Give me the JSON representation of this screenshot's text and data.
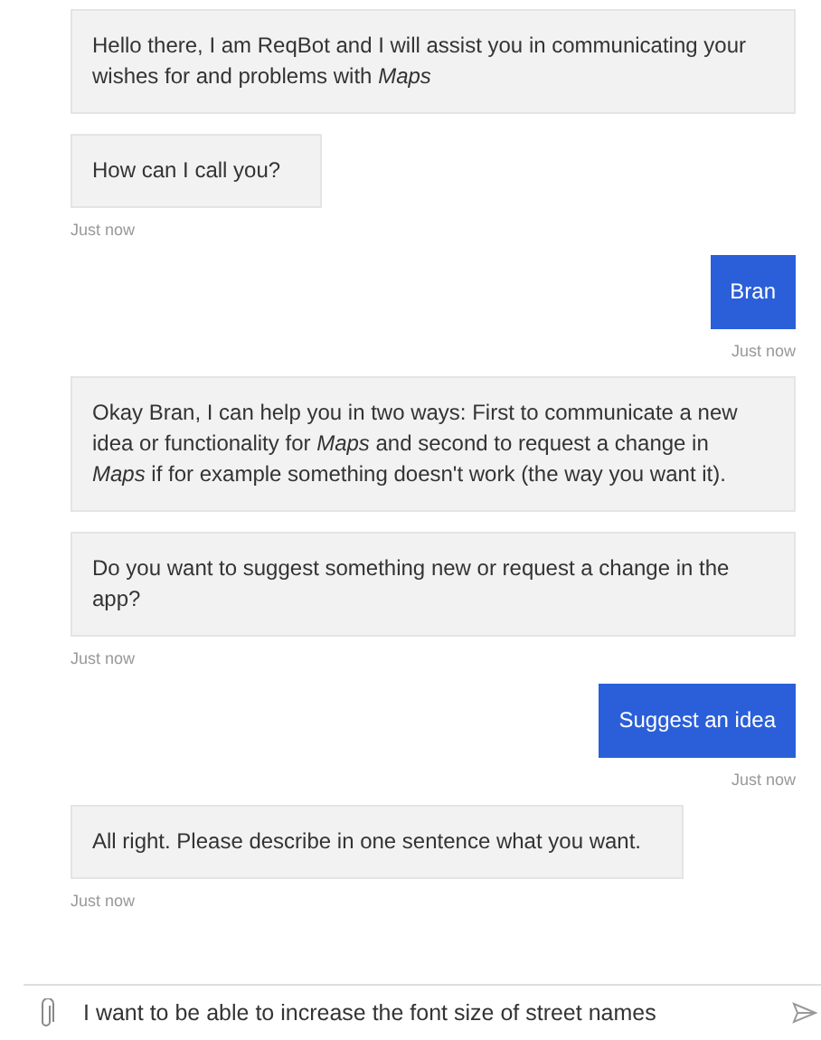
{
  "messages": [
    {
      "kind": "bot",
      "bubbles": [
        "Hello there, I am ReqBot and I will assist you in communicating your wishes for and problems with *Maps*",
        "How can I call you?"
      ],
      "time": "Just now"
    },
    {
      "kind": "user",
      "bubbles": [
        "Bran"
      ],
      "time": "Just now"
    },
    {
      "kind": "bot",
      "bubbles": [
        "Okay Bran, I can help you in two ways: First to communicate a new idea or functionality for *Maps* and second to request a change in *Maps* if for example something doesn't work (the way you want it).",
        "Do you want to suggest something new or request a change in the app?"
      ],
      "time": "Just now"
    },
    {
      "kind": "user",
      "bubbles": [
        "Suggest an idea"
      ],
      "time": "Just now"
    },
    {
      "kind": "bot",
      "bubbles": [
        "All right. Please describe in one sentence what you want."
      ],
      "time": "Just now"
    }
  ],
  "composer": {
    "value": "I want to be able to increase the font size of street names"
  }
}
